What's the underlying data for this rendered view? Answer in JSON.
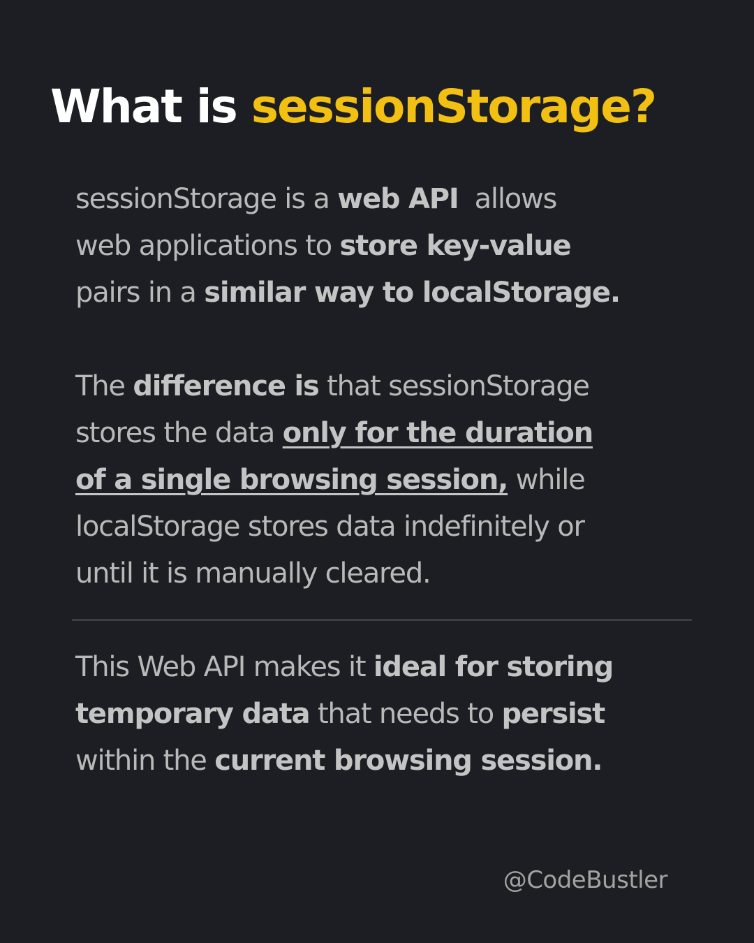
{
  "title": {
    "prefix": "What is",
    "highlight": "sessionStorage?"
  },
  "colors": {
    "background": "#1c1e23",
    "title": "#ffffff",
    "accent": "#f2c012",
    "body_text": "#b9b9b9",
    "divider": "#3b3e45",
    "handle": "#a3a3a3"
  },
  "paragraph1": {
    "lines": [
      [
        {
          "text": "sessionStorage is a ",
          "style": "normal"
        },
        {
          "text": "web API",
          "style": "bold"
        },
        {
          "text": "  allows",
          "style": "normal"
        }
      ],
      [
        {
          "text": "web applications to ",
          "style": "normal"
        },
        {
          "text": "store key-value",
          "style": "bold"
        }
      ],
      [
        {
          "text": "pairs in a ",
          "style": "normal"
        },
        {
          "text": "similar way to localStorage.",
          "style": "bold"
        }
      ]
    ]
  },
  "paragraph2": {
    "lines": [
      [
        {
          "text": "The ",
          "style": "normal"
        },
        {
          "text": "difference is",
          "style": "bold"
        },
        {
          "text": " that sessionStorage",
          "style": "normal"
        }
      ],
      [
        {
          "text": "stores the data ",
          "style": "normal"
        },
        {
          "text": "only for the duration",
          "style": "bold-underline"
        }
      ],
      [
        {
          "text": "of a single browsing session,",
          "style": "bold-underline"
        },
        {
          "text": " while",
          "style": "normal"
        }
      ],
      [
        {
          "text": "localStorage stores data indefinitely or",
          "style": "normal"
        }
      ],
      [
        {
          "text": "until it is manually cleared.",
          "style": "normal"
        }
      ]
    ]
  },
  "paragraph3": {
    "lines": [
      [
        {
          "text": "This Web API makes it ",
          "style": "normal"
        },
        {
          "text": "ideal for storing",
          "style": "bold"
        }
      ],
      [
        {
          "text": "temporary data",
          "style": "bold"
        },
        {
          "text": " that needs to ",
          "style": "normal"
        },
        {
          "text": "persist",
          "style": "bold"
        }
      ],
      [
        {
          "text": "within the ",
          "style": "normal"
        },
        {
          "text": "current browsing session.",
          "style": "bold"
        }
      ]
    ]
  },
  "handle": "@CodeBustler"
}
